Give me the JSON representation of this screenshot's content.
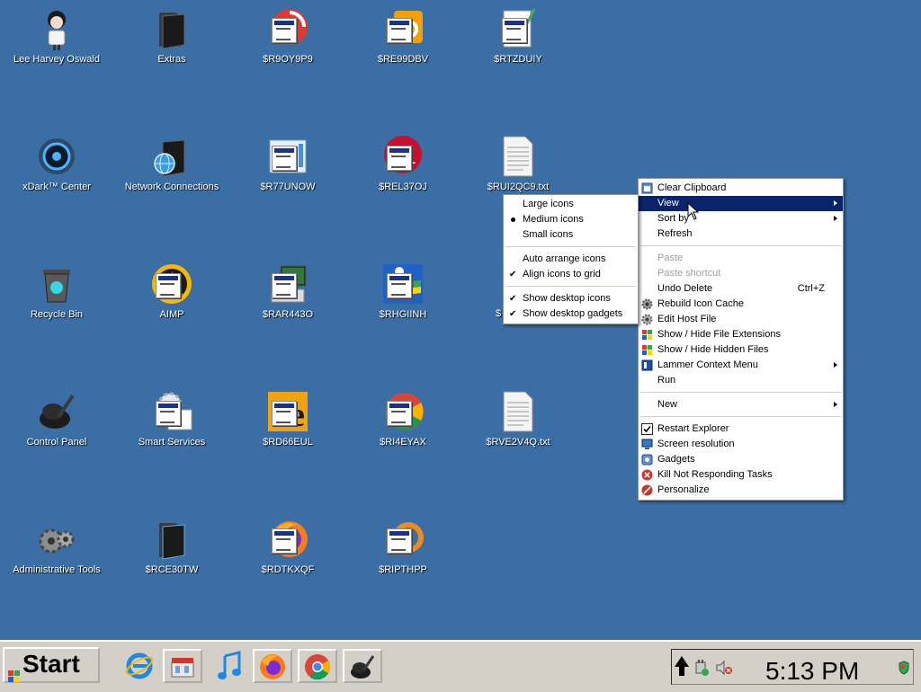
{
  "desktop": {
    "icons": [
      {
        "label": "Lee Harvey Oswald"
      },
      {
        "label": "Extras"
      },
      {
        "label": "$R9OY9P9"
      },
      {
        "label": "$RE99DBV"
      },
      {
        "label": "$RTZDUIY"
      },
      {
        "label": "xDark™ Center"
      },
      {
        "label": "Network Connections"
      },
      {
        "label": "$R77UNOW"
      },
      {
        "label": "$REL37OJ"
      },
      {
        "label": "$RUI2QC9.txt"
      },
      {
        "label": "Recycle Bin"
      },
      {
        "label": "AIMP"
      },
      {
        "label": "$RAR443O"
      },
      {
        "label": "$RHGIINH"
      },
      {
        "label": "Control Panel"
      },
      {
        "label": "Smart Services"
      },
      {
        "label": "$RD66EUL"
      },
      {
        "label": "$RI4EYAX"
      },
      {
        "label": "$RVE2V4Q.txt"
      },
      {
        "label": "Administrative Tools"
      },
      {
        "label": "$RCE30TW"
      },
      {
        "label": "$RDTKXQF"
      },
      {
        "label": "$RIPTHPP"
      }
    ],
    "partial_label": "$"
  },
  "context_menu": {
    "items": [
      {
        "label": "Clear Clipboard"
      },
      {
        "label": "View"
      },
      {
        "label": "Sort by"
      },
      {
        "label": "Refresh"
      },
      {
        "label": "Paste"
      },
      {
        "label": "Paste shortcut"
      },
      {
        "label": "Undo Delete",
        "shortcut": "Ctrl+Z"
      },
      {
        "label": "Rebuild Icon Cache"
      },
      {
        "label": "Edit Host File"
      },
      {
        "label": "Show / Hide File Extensions"
      },
      {
        "label": "Show / Hide Hidden Files"
      },
      {
        "label": "Lammer Context Menu"
      },
      {
        "label": "Run"
      },
      {
        "label": "New"
      },
      {
        "label": "Restart Explorer"
      },
      {
        "label": "Screen resolution"
      },
      {
        "label": "Gadgets"
      },
      {
        "label": "Kill Not Responding Tasks"
      },
      {
        "label": "Personalize"
      }
    ]
  },
  "view_submenu": {
    "items": [
      {
        "label": "Large icons"
      },
      {
        "label": "Medium icons"
      },
      {
        "label": "Small icons"
      },
      {
        "label": "Auto arrange icons"
      },
      {
        "label": "Align icons to grid"
      },
      {
        "label": "Show desktop icons"
      },
      {
        "label": "Show desktop gadgets"
      }
    ]
  },
  "taskbar": {
    "start_label": "Start",
    "clock": "5:13 PM"
  },
  "colors": {
    "desktop_bg": "#3a6ea5",
    "menu_highlight": "#0a246a",
    "taskbar_bg": "#d4d0c8"
  }
}
